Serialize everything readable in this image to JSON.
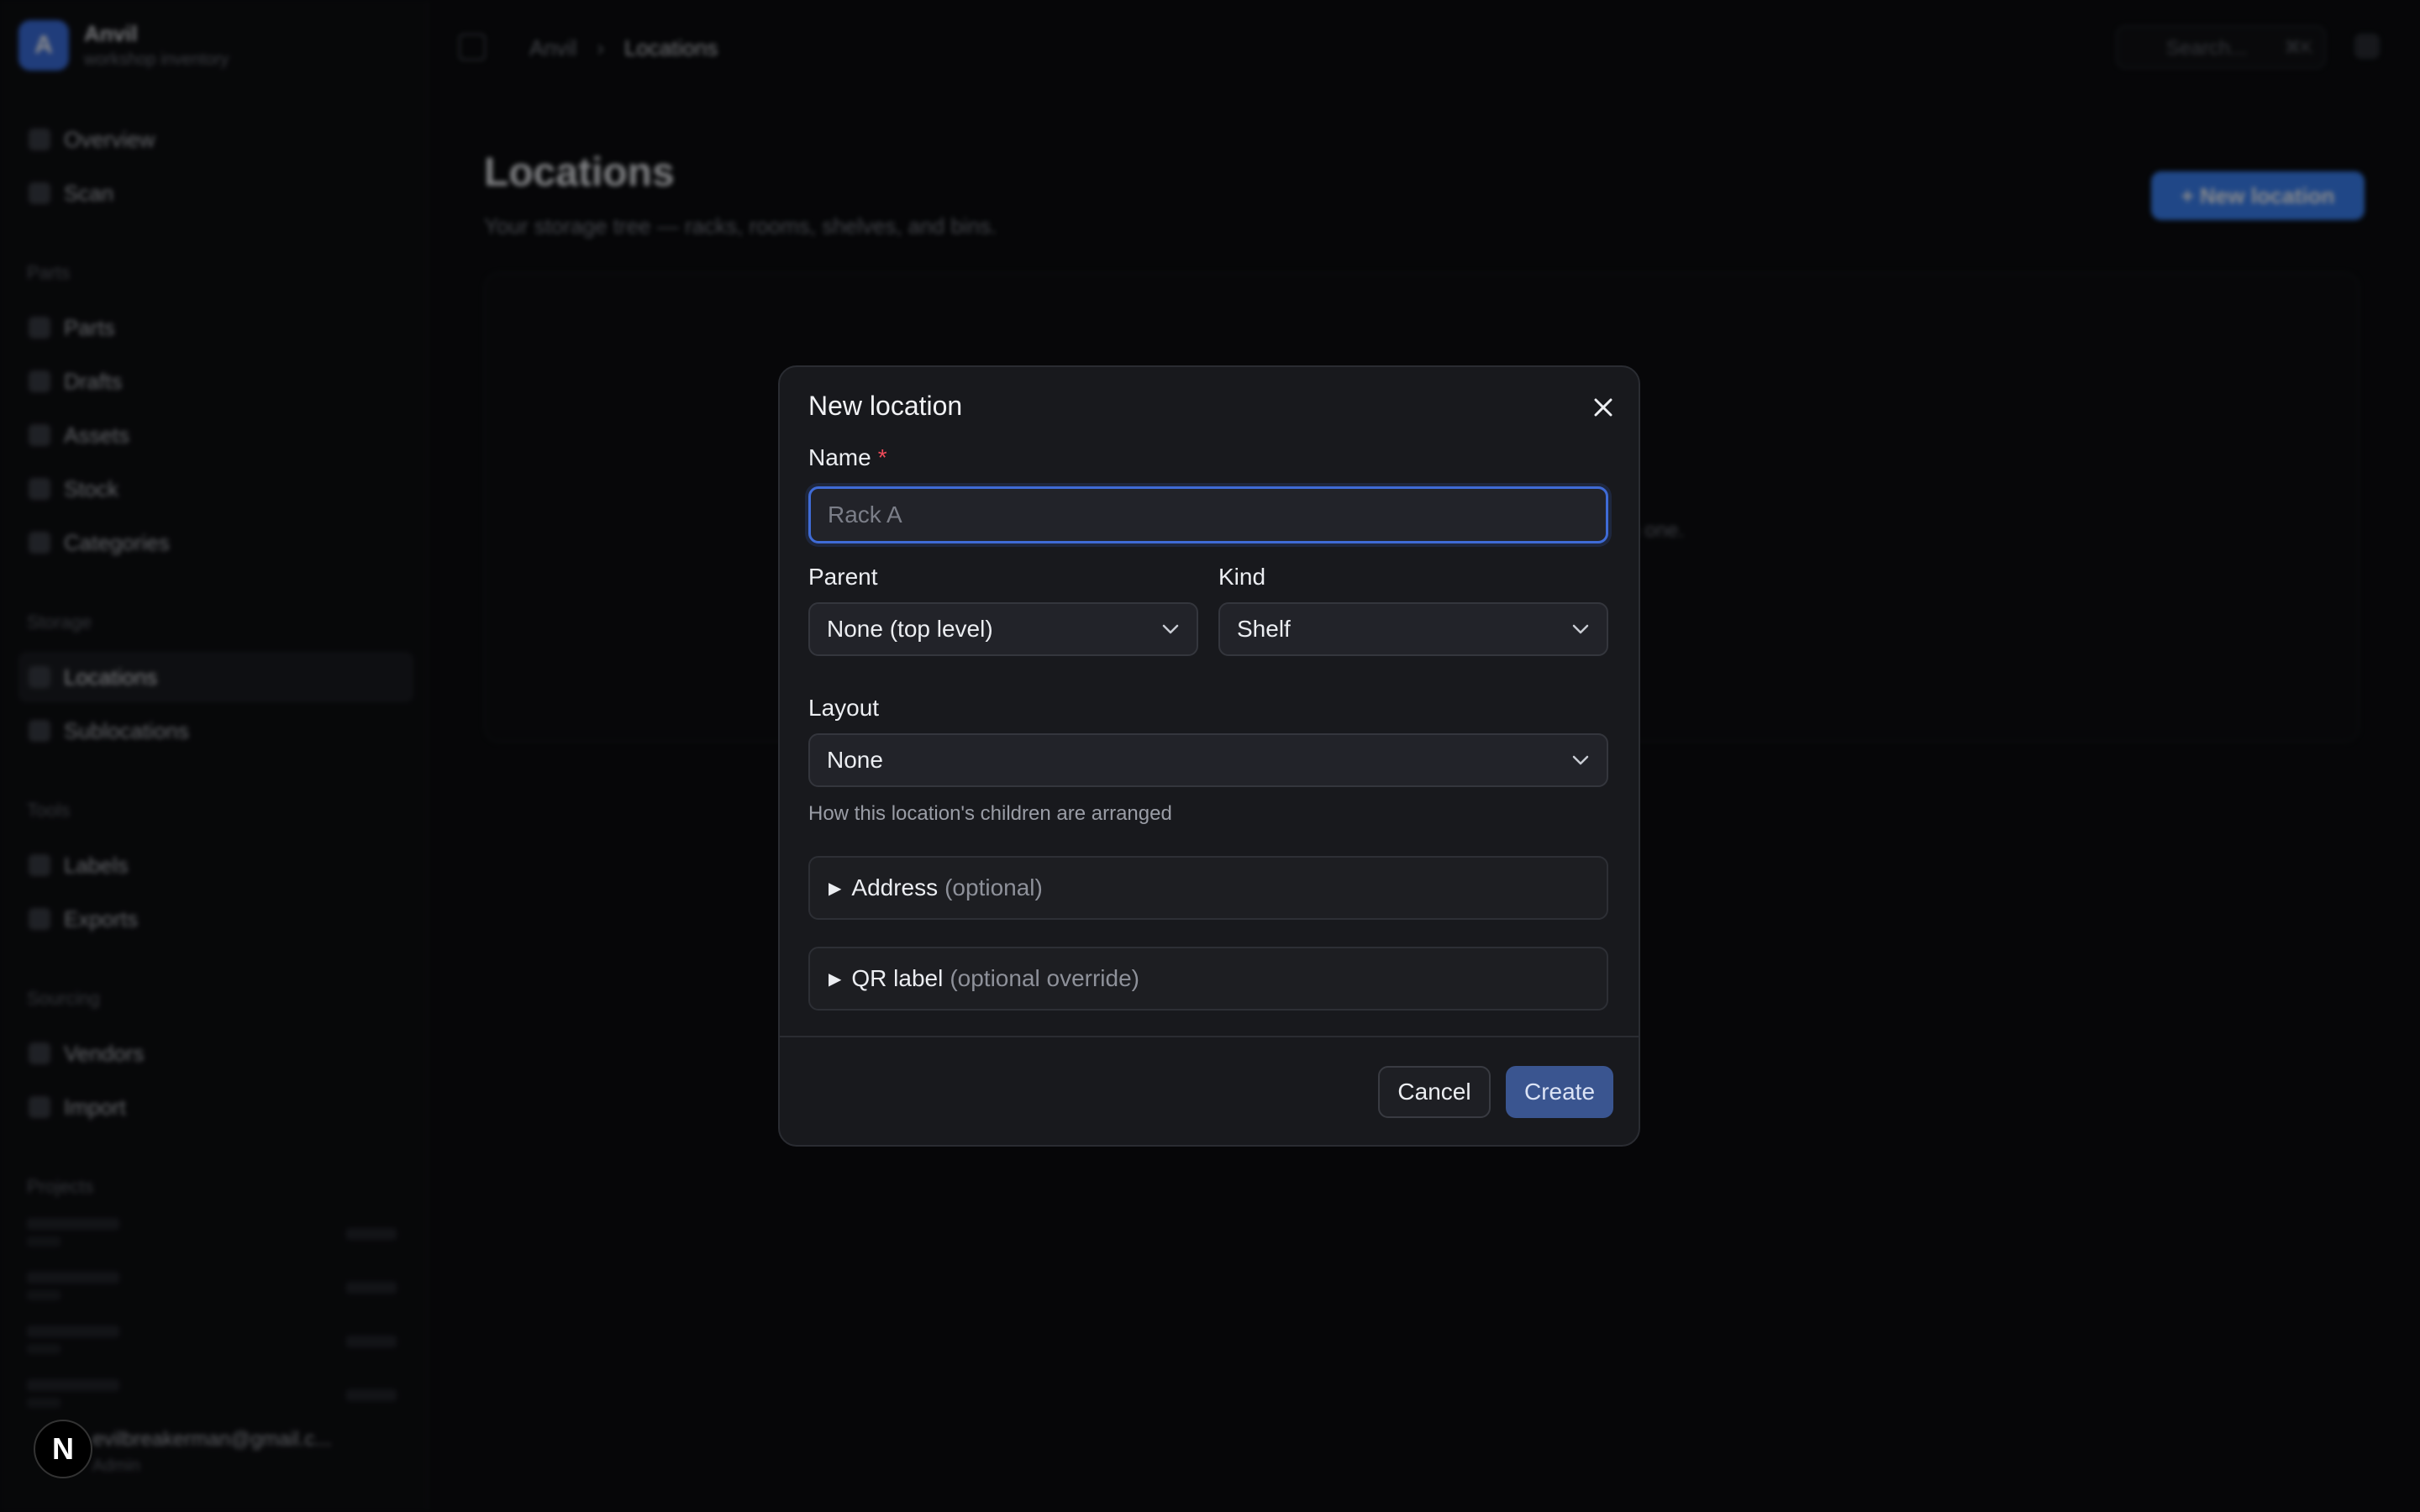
{
  "app": {
    "brand_name": "Anvil",
    "brand_sub": "workshop inventory",
    "brand_initial": "A"
  },
  "sidebar": {
    "items_top": [
      {
        "label": "Overview",
        "icon": "grid-icon"
      },
      {
        "label": "Scan",
        "icon": "scan-icon"
      }
    ],
    "sections": [
      {
        "title": "Parts",
        "items": [
          {
            "label": "Parts",
            "icon": "box-icon"
          },
          {
            "label": "Drafts",
            "icon": "draft-icon"
          },
          {
            "label": "Assets",
            "icon": "wrench-icon"
          },
          {
            "label": "Stock",
            "icon": "stack-icon"
          },
          {
            "label": "Categories",
            "icon": "tag-icon"
          }
        ]
      },
      {
        "title": "Storage",
        "items": [
          {
            "label": "Locations",
            "icon": "location-icon",
            "active": true
          },
          {
            "label": "Sublocations",
            "icon": "sublocation-icon"
          }
        ]
      },
      {
        "title": "Tools",
        "items": [
          {
            "label": "Labels",
            "icon": "label-icon"
          },
          {
            "label": "Exports",
            "icon": "export-icon"
          }
        ]
      },
      {
        "title": "Sourcing",
        "items": [
          {
            "label": "Vendors",
            "icon": "vendor-icon"
          },
          {
            "label": "Import",
            "icon": "import-icon"
          }
        ]
      }
    ],
    "projects_title": "Projects",
    "user_email": "evilbreakerman@gmail.c...",
    "user_role": "Admin"
  },
  "topbar": {
    "breadcrumb_root": "Anvil",
    "breadcrumb_sep": "›",
    "breadcrumb_current": "Locations",
    "search_placeholder": "Search...",
    "search_shortcut": "⌘K"
  },
  "page": {
    "title": "Locations",
    "subtitle": "Your storage tree — racks, rooms, shelves, and bins.",
    "new_button": "+ New location",
    "empty_hint": "ns in one."
  },
  "modal": {
    "title": "New location",
    "close_icon": "close-icon",
    "name_label": "Name",
    "name_required": "*",
    "name_placeholder": "Rack A",
    "name_value": "",
    "parent_label": "Parent",
    "parent_value": "None (top level)",
    "kind_label": "Kind",
    "kind_value": "Shelf",
    "layout_label": "Layout",
    "layout_value": "None",
    "layout_helper": "How this location's children are arranged",
    "address_label": "Address",
    "address_hint": "(optional)",
    "qr_label": "QR label",
    "qr_hint": "(optional override)",
    "cancel_label": "Cancel",
    "create_label": "Create"
  },
  "badge": {
    "label": "N"
  },
  "colors": {
    "accent": "#3f6bd6",
    "create_button": "#3a5590",
    "required": "#f04b5a",
    "modal_bg": "#18191d"
  }
}
